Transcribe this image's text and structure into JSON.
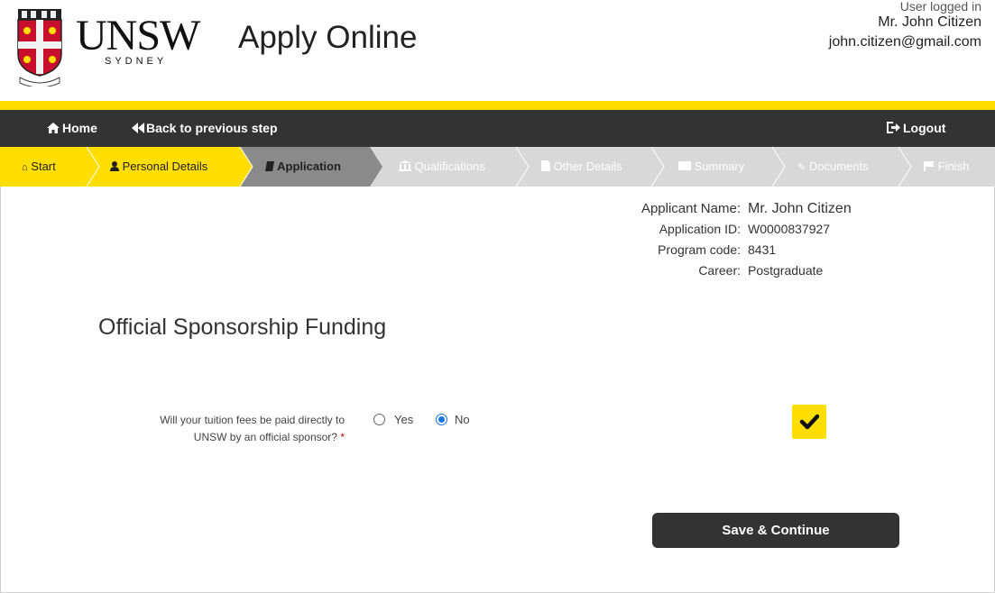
{
  "header": {
    "logo_text": "UNSW",
    "logo_subtext": "SYDNEY",
    "app_title": "Apply Online",
    "user_logged_label": "User logged in",
    "user_name": "Mr. John Citizen",
    "user_email": "john.citizen@gmail.com"
  },
  "nav": {
    "home": "Home",
    "back": "Back to previous step",
    "logout": "Logout"
  },
  "steps": [
    {
      "label": "Start",
      "icon": "home-icon",
      "state": "done"
    },
    {
      "label": "Personal Details",
      "icon": "user-icon",
      "state": "done"
    },
    {
      "label": "Application",
      "icon": "book-icon",
      "state": "current"
    },
    {
      "label": "Qualifications",
      "icon": "institution-icon",
      "state": "pending"
    },
    {
      "label": "Other Details",
      "icon": "file-icon",
      "state": "pending"
    },
    {
      "label": "Summary",
      "icon": "list-icon",
      "state": "pending"
    },
    {
      "label": "Documents",
      "icon": "paperclip-icon",
      "state": "pending"
    },
    {
      "label": "Finish",
      "icon": "flag-icon",
      "state": "pending"
    }
  ],
  "applicant": {
    "name_label": "Applicant Name:",
    "name_value": "Mr. John Citizen",
    "id_label": "Application ID:",
    "id_value": "W0000837927",
    "program_label": "Program code:",
    "program_value": "8431",
    "career_label": "Career:",
    "career_value": "Postgraduate"
  },
  "section_title": "Official Sponsorship Funding",
  "question": {
    "line1": "Will your tuition fees be paid directly to",
    "line2": "UNSW by an official sponsor?",
    "required_mark": "*",
    "options": [
      "Yes",
      "No"
    ],
    "selected": "No"
  },
  "save_button": "Save & Continue",
  "colors": {
    "brand_yellow": "#ffde00",
    "nav_dark": "#333333",
    "step_current": "#8a8a8a",
    "step_pending": "#d8d8d8"
  }
}
